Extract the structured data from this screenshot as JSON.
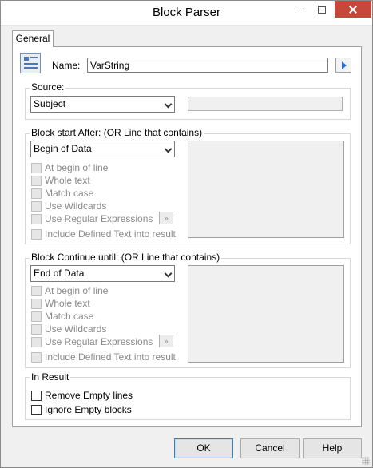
{
  "window": {
    "title": "Block Parser",
    "controls": [
      "minimize",
      "maximize",
      "close"
    ]
  },
  "tab": {
    "label": "General"
  },
  "name": {
    "label": "Name:",
    "value": "VarString",
    "icon": "form-icon",
    "arrow_icon": "play-arrow-icon"
  },
  "source": {
    "title": "Source:",
    "selected": "Subject",
    "text_value": ""
  },
  "block_start": {
    "title": "Block start After: (OR Line that contains)",
    "selected": "Begin of Data",
    "options": [
      {
        "label": "At begin of line",
        "checked": false,
        "enabled": false
      },
      {
        "label": "Whole text",
        "checked": false,
        "enabled": false
      },
      {
        "label": "Match case",
        "checked": false,
        "enabled": false
      },
      {
        "label": "Use Wildcards",
        "checked": false,
        "enabled": false
      },
      {
        "label": "Use Regular Expressions",
        "checked": false,
        "enabled": false
      },
      {
        "label": "Include Defined Text into result",
        "checked": false,
        "enabled": false
      }
    ],
    "regex_button": "»"
  },
  "block_continue": {
    "title": "Block Continue until: (OR Line that contains)",
    "selected": "End of Data",
    "options": [
      {
        "label": "At begin of line",
        "checked": false,
        "enabled": false
      },
      {
        "label": "Whole text",
        "checked": false,
        "enabled": false
      },
      {
        "label": "Match case",
        "checked": false,
        "enabled": false
      },
      {
        "label": "Use Wildcards",
        "checked": false,
        "enabled": false
      },
      {
        "label": "Use Regular Expressions",
        "checked": false,
        "enabled": false
      },
      {
        "label": "Include Defined Text into result",
        "checked": false,
        "enabled": false
      }
    ],
    "regex_button": "»"
  },
  "in_result": {
    "title": "In Result",
    "options": [
      {
        "label": "Remove Empty lines",
        "checked": false,
        "enabled": true
      },
      {
        "label": "Ignore Empty blocks",
        "checked": false,
        "enabled": true
      }
    ]
  },
  "buttons": {
    "ok": "OK",
    "cancel": "Cancel",
    "help": "Help"
  },
  "colors": {
    "accent": "#2a6fd6",
    "close": "#c7483b",
    "disabled_text": "#8a8a8a"
  }
}
